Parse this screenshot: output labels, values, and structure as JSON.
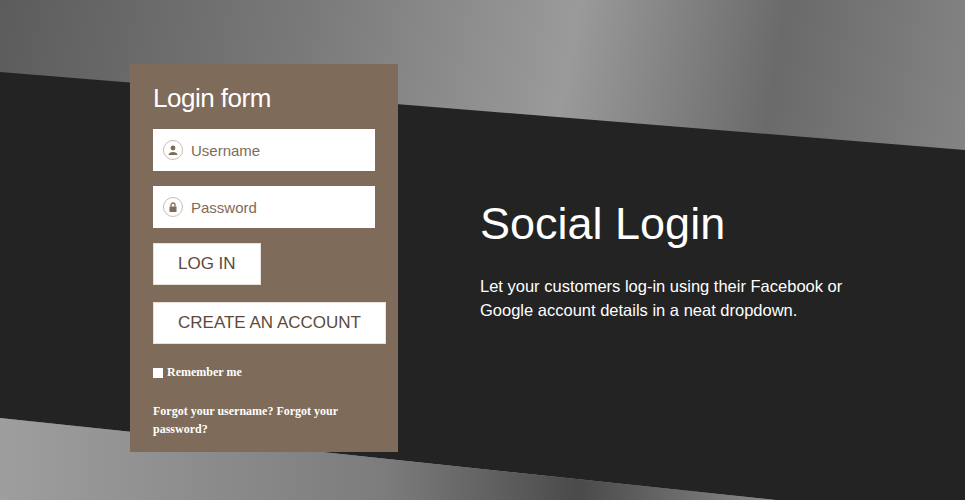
{
  "login": {
    "title": "Login form",
    "username": {
      "placeholder": "Username"
    },
    "password": {
      "placeholder": "Password"
    },
    "buttons": [
      "LOG IN",
      "CREATE AN ACCOUNT"
    ],
    "remember": {
      "label": "Remember me",
      "checked": false
    },
    "forgot": "Forgot your username? Forgot your password?"
  },
  "feature": {
    "title": "Social Login",
    "description": "Let your customers log-in using their Facebook or Google account details in a neat dropdown."
  }
}
